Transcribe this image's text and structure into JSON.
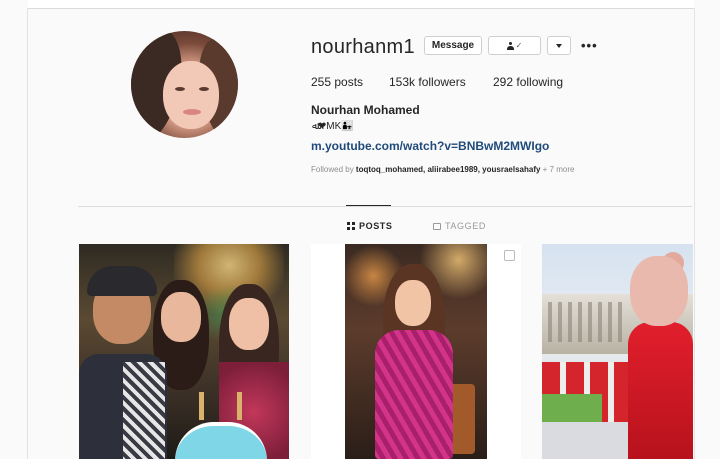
{
  "profile": {
    "username": "nourhanm1",
    "stats": {
      "posts": "255 posts",
      "followers": "153k followers",
      "following": "292 following"
    },
    "full_name": "Nourhan Mohamed",
    "bio": "ﷲ❤MK👨‍👧",
    "link": "m.youtube.com/watch?v=BNBwM2MWIgo",
    "followed_by": {
      "prefix": "Followed by ",
      "names": "toqtoq_mohamed, aliirabee1989, yousraelsahafy",
      "more": " + 7 more"
    }
  },
  "actions": {
    "message_label": "Message",
    "following_check": "✓",
    "more_label": "•••"
  },
  "tabs": [
    {
      "label": "POSTS",
      "active": true,
      "icon": "grid-icon"
    },
    {
      "label": "TAGGED",
      "active": false,
      "icon": "tag-icon"
    }
  ],
  "posts": [
    {
      "description_icon": "group-birthday-photo"
    },
    {
      "description_icon": "woman-sequin-dress-photo"
    },
    {
      "description_icon": "woman-red-coat-teddy-bear-photo"
    }
  ],
  "colors": {
    "link": "#1f4a7a",
    "muted": "#8e8e8e",
    "text": "#262626",
    "border": "#dbdbdb"
  }
}
